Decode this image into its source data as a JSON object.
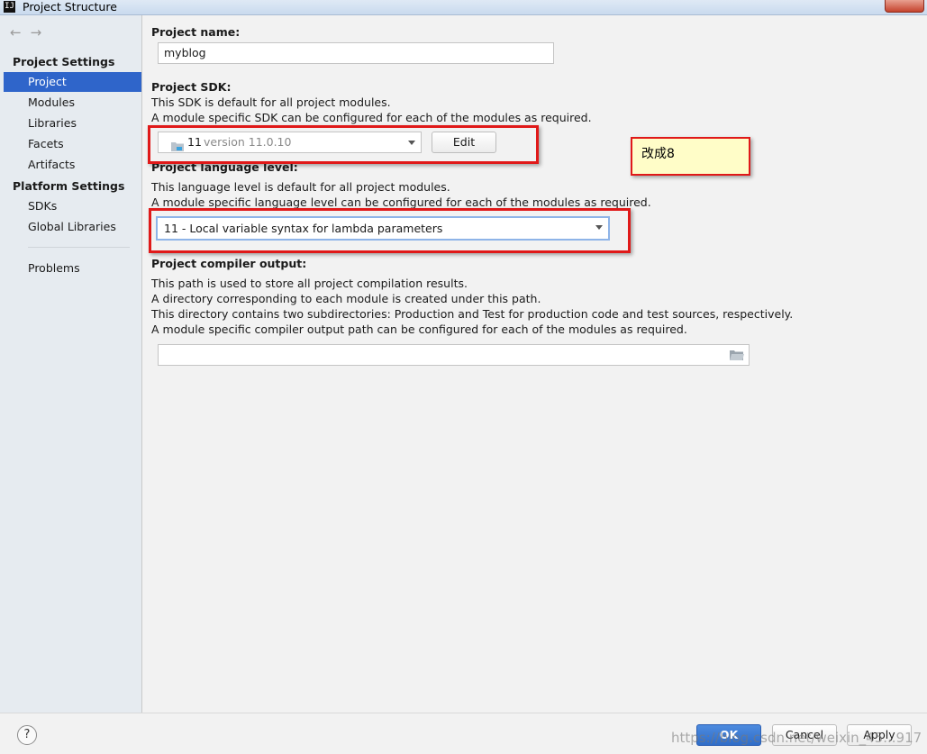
{
  "window": {
    "title": "Project Structure"
  },
  "sidebar": {
    "nav_back": "←",
    "nav_forward": "→",
    "project_settings_title": "Project Settings",
    "project_settings_items": [
      "Project",
      "Modules",
      "Libraries",
      "Facets",
      "Artifacts"
    ],
    "platform_settings_title": "Platform Settings",
    "platform_settings_items": [
      "SDKs",
      "Global Libraries"
    ],
    "other_items": [
      "Problems"
    ],
    "selected": "Project"
  },
  "project_name": {
    "label": "Project name:",
    "value": "myblog"
  },
  "project_sdk": {
    "label": "Project SDK:",
    "desc1": "This SDK is default for all project modules.",
    "desc2": "A module specific SDK can be configured for each of the modules as required.",
    "selected_name": "11",
    "selected_version": "version 11.0.10",
    "edit_button": "Edit"
  },
  "language_level": {
    "label": "Project language level:",
    "desc1": "This language level is default for all project modules.",
    "desc2": "A module specific language level can be configured for each of the modules as required.",
    "selected": "11 - Local variable syntax for lambda parameters"
  },
  "compiler_output": {
    "label": "Project compiler output:",
    "desc1": "This path is used to store all project compilation results.",
    "desc2": "A directory corresponding to each module is created under this path.",
    "desc3": "This directory contains two subdirectories: Production and Test for production code and test sources, respectively.",
    "desc4": "A module specific compiler output path can be configured for each of the modules as required.",
    "value": ""
  },
  "annotation": {
    "note": "改成8",
    "highlight_color": "#e01919"
  },
  "footer": {
    "help": "?",
    "ok": "OK",
    "cancel": "Cancel",
    "apply": "Apply",
    "watermark": "https://blog.csdn.net/weixin_45...917"
  },
  "colors": {
    "selection": "#2f65ca",
    "sidebar_bg": "#e6ebf0",
    "content_bg": "#f2f2f2",
    "note_bg": "#fffdc8"
  }
}
